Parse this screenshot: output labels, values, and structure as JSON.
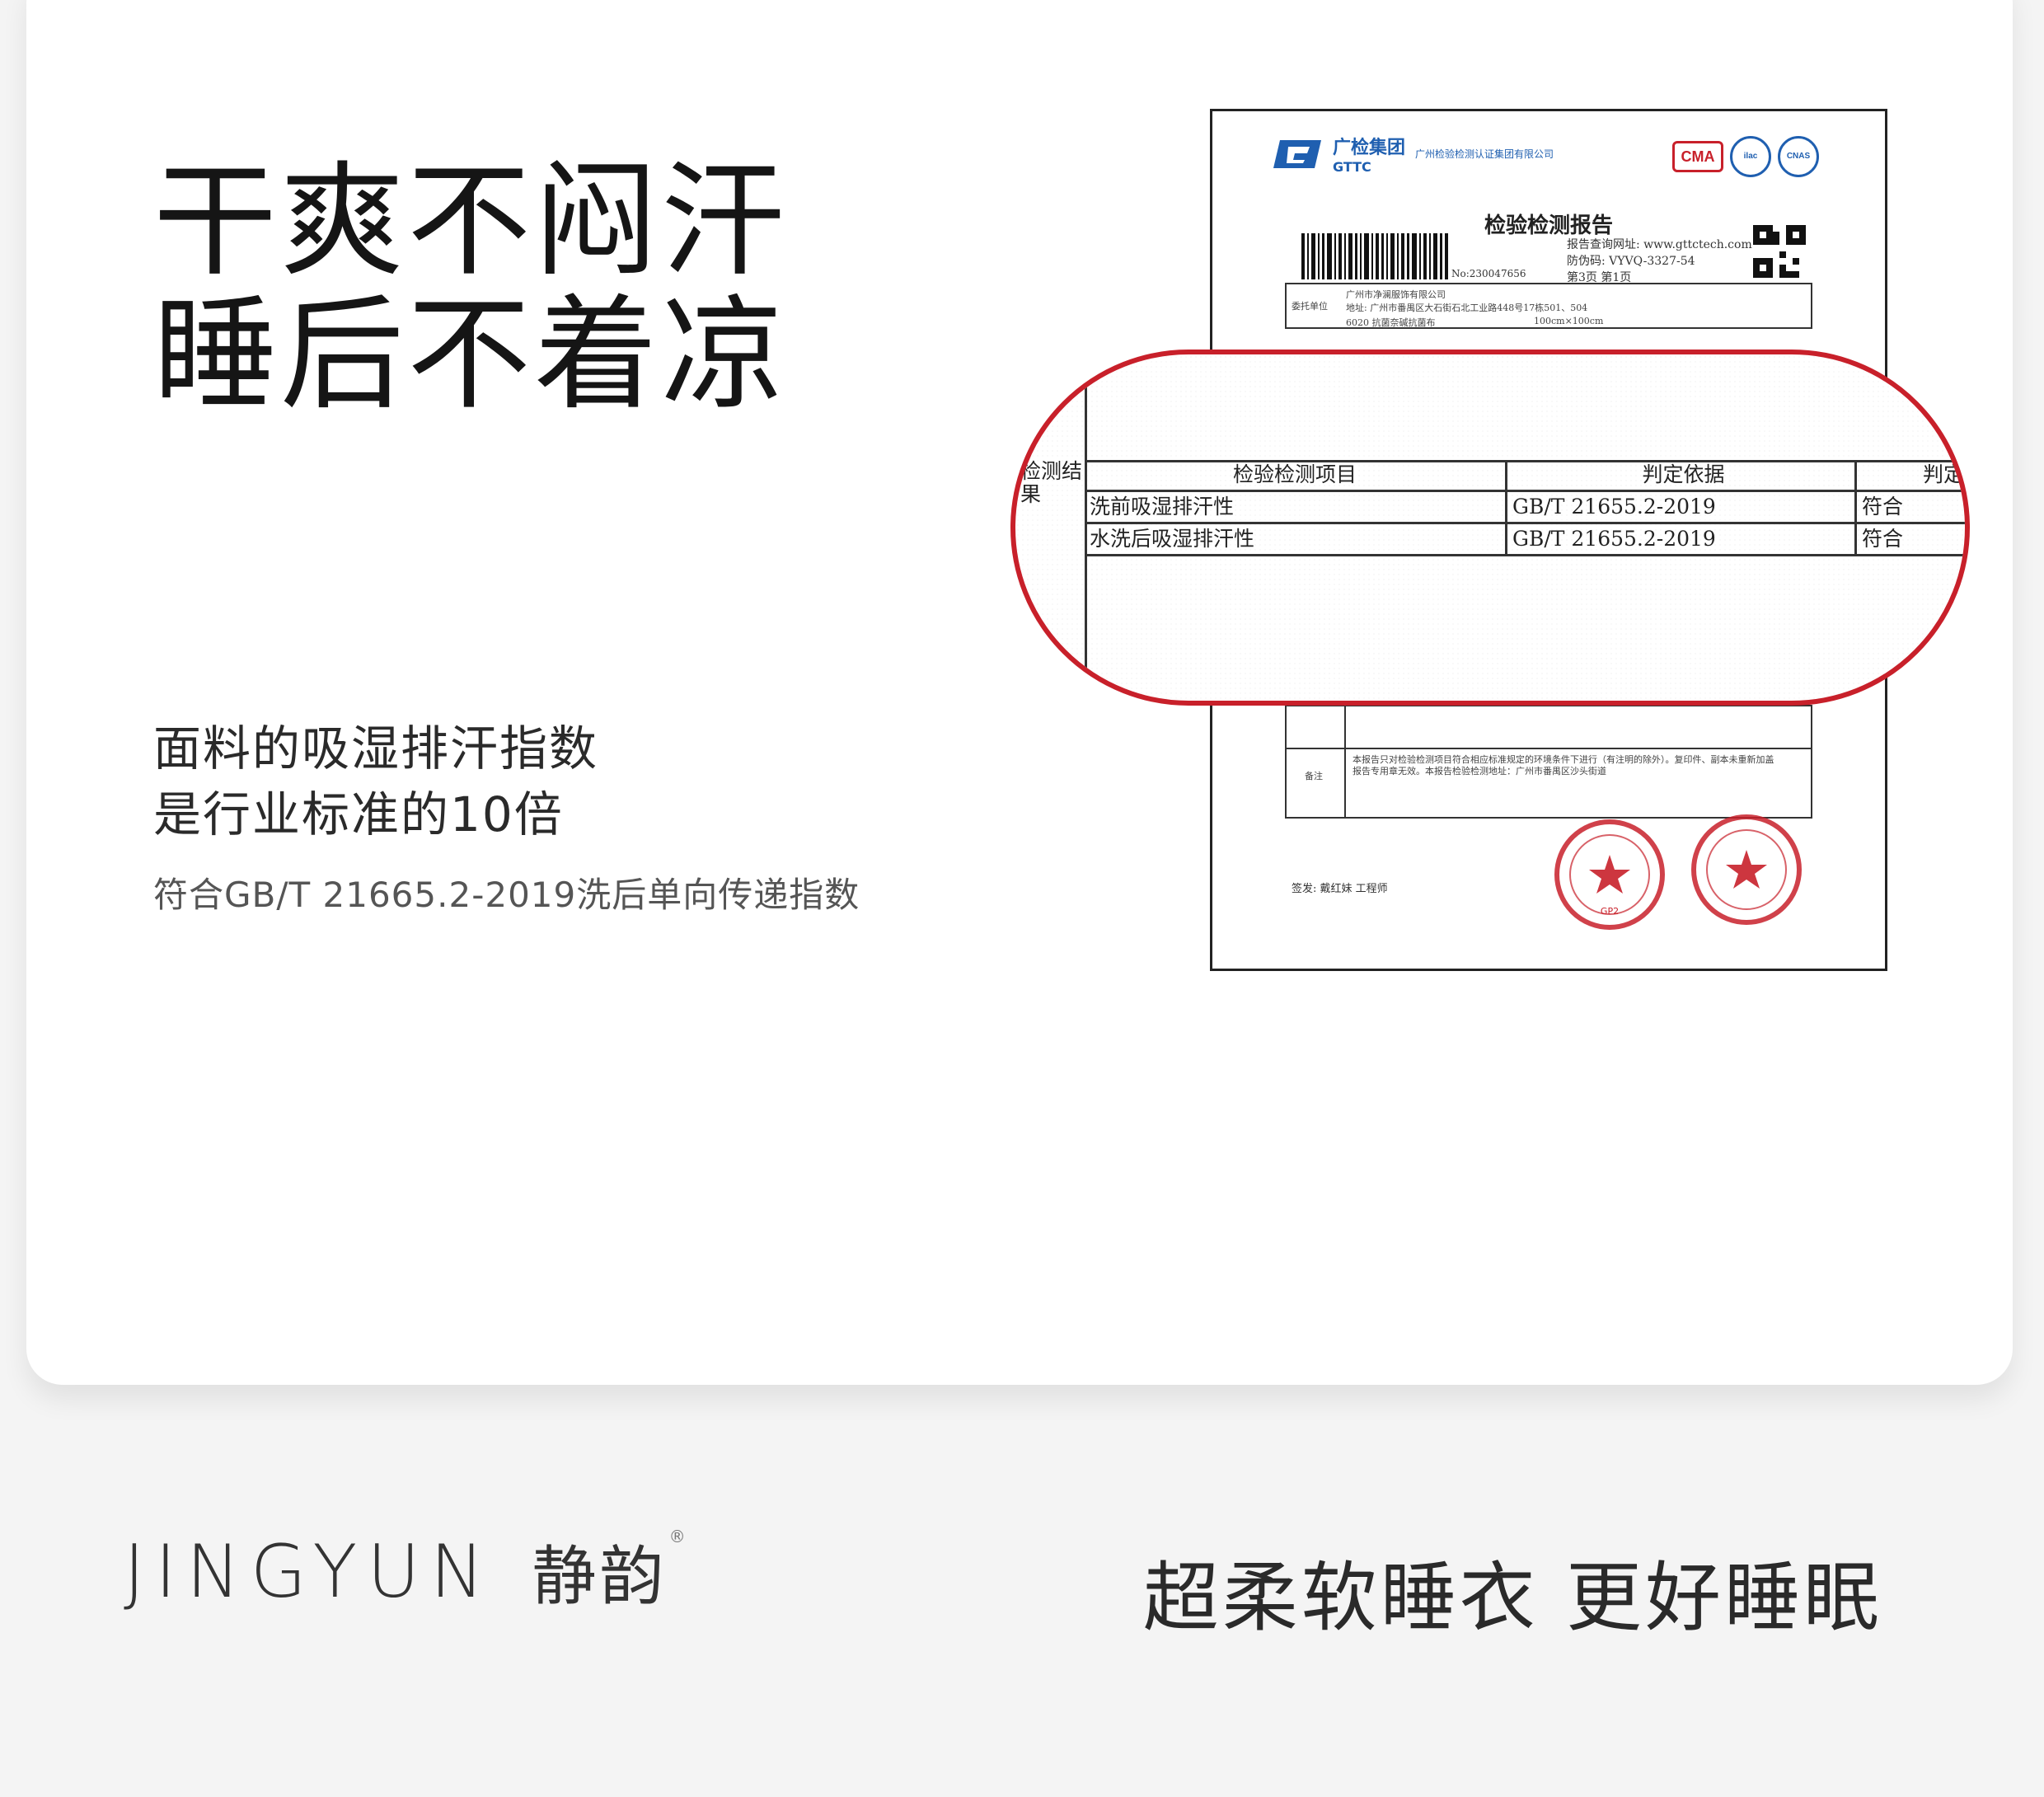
{
  "headline": {
    "line1": "干爽不闷汗",
    "line2": "睡后不着凉"
  },
  "subhead": {
    "line1": "面料的吸湿排汗指数",
    "line2": "是行业标准的10倍"
  },
  "note": "符合GB/T 21665.2-2019洗后单向传递指数",
  "report": {
    "org_name": "广检集团",
    "org_abbr": "GTTC",
    "org_full": "广州检验检测认证集团有限公司",
    "cert_marks": [
      "CMA",
      "CNAS"
    ],
    "title": "检验检测报告",
    "query_site": "报告查询网址: www.gttctech.com",
    "report_code_label": "防伪码: VYVQ-3327-54",
    "page": "第3页 第1页",
    "report_no": "No:230047656",
    "client_label": "委托单位",
    "client_name": "广州市净澜服饰有限公司",
    "client_addr": "地址: 广州市番禺区大石街石北工业路448号17栋501、504",
    "sample_name": "6020 抗菌奈碱抗菌布",
    "sample_spec": "100cm×100cm",
    "remark_label": "备注",
    "remark_text": "本报告只对检验检测项目符合相应标准规定的环境条件下进行（有注明的除外）。复印件、副本未重新加盖报告专用章无效。本报告检验检测地址：广州市番禺区沙头街道",
    "sign_row": "签发: 戴红妹  工程师",
    "stamp1": "广州检验检测认证集团有限公司 检验检测专用章 (GP2)",
    "stamp2": "检验检测专用章"
  },
  "callout": {
    "side_label": "检测结果",
    "header": {
      "item": "检验检测项目",
      "basis": "判定依据",
      "verdict": "判定"
    },
    "rows": [
      {
        "item": "洗前吸湿排汗性",
        "basis": "GB/T 21655.2-2019",
        "verdict": "符合"
      },
      {
        "item": "水洗后吸湿排汗性",
        "basis": "GB/T 21655.2-2019",
        "verdict": "符合"
      }
    ]
  },
  "footer": {
    "brand_en": "JINGYUN",
    "brand_cn": "静韵",
    "reg_mark": "®",
    "slogan": "超柔软睡衣 更好睡眠"
  },
  "colors": {
    "accent_red": "#c8202a",
    "brand_blue": "#1f5fb0",
    "text_dark": "#151515",
    "background": "#f4f4f4"
  }
}
